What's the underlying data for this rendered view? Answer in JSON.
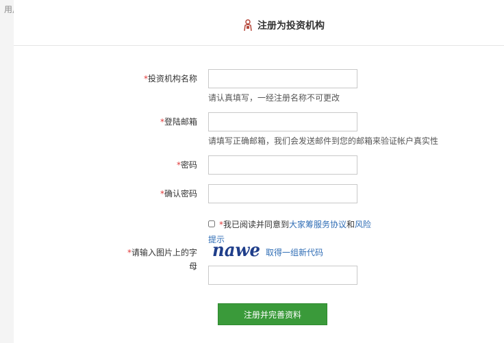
{
  "guide": {
    "label": "用户指南"
  },
  "header": {
    "title": "注册为投资机构",
    "icon": "user-register-icon"
  },
  "form": {
    "required_mark": "*",
    "org_name": {
      "label": "投资机构名称",
      "value": "",
      "hint": "请认真填写，一经注册名称不可更改"
    },
    "email": {
      "label": "登陆邮箱",
      "value": "",
      "hint": "请填写正确邮箱，我们会发送邮件到您的邮箱来验证帐户真实性"
    },
    "password": {
      "label": "密码",
      "value": ""
    },
    "confirm_password": {
      "label": "确认密码",
      "value": ""
    },
    "agreement": {
      "prefix": "我已阅读并同意到",
      "service_link": "大家筹服务协议",
      "conjunction": "和",
      "risk_link": "风险提示",
      "checked": false
    },
    "captcha": {
      "label": "请输入图片上的字母",
      "image_text": "nawe",
      "refresh_link": "取得一组新代码",
      "value": ""
    },
    "submit_label": "注册并完善资料"
  },
  "colors": {
    "accent": "#3a9a3a",
    "link": "#2f6db5",
    "required": "#e03a3a"
  }
}
